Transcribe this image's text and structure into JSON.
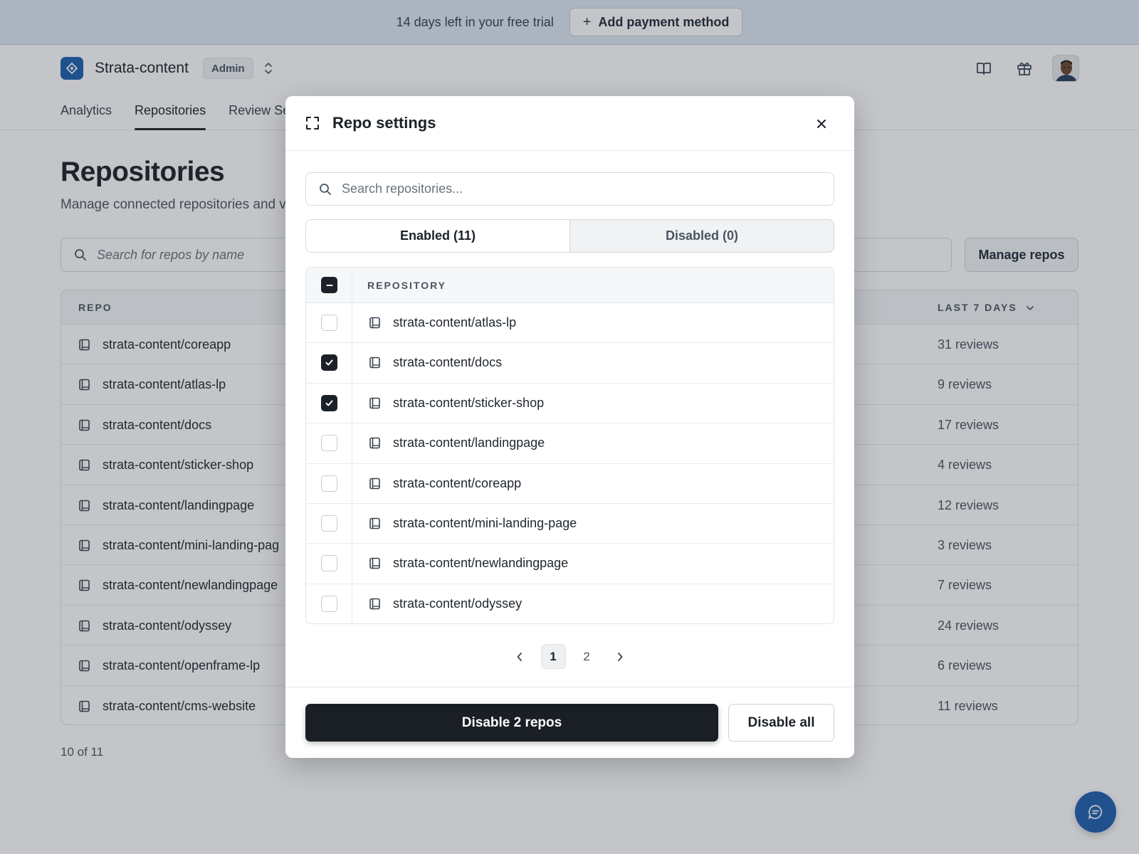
{
  "trial": {
    "text": "14 days left in your free trial",
    "button_label": "Add payment method"
  },
  "header": {
    "org_name": "Strata-content",
    "role_badge": "Admin"
  },
  "nav": {
    "tabs": [
      {
        "label": "Analytics"
      },
      {
        "label": "Repositories"
      },
      {
        "label": "Review Se"
      }
    ]
  },
  "page": {
    "title": "Repositories",
    "subtitle": "Manage connected repositories and vi",
    "search_placeholder": "Search for repos by name",
    "manage_button": "Manage repos",
    "table_headers": {
      "repo": "REPO",
      "last7": "LAST 7 DAYS"
    },
    "rows": [
      {
        "name": "strata-content/coreapp",
        "reviews": "31 reviews"
      },
      {
        "name": "strata-content/atlas-lp",
        "reviews": "9 reviews"
      },
      {
        "name": "strata-content/docs",
        "reviews": "17 reviews"
      },
      {
        "name": "strata-content/sticker-shop",
        "reviews": "4 reviews"
      },
      {
        "name": "strata-content/landingpage",
        "reviews": "12 reviews"
      },
      {
        "name": "strata-content/mini-landing-pag",
        "reviews": "3 reviews"
      },
      {
        "name": "strata-content/newlandingpage",
        "reviews": "7 reviews"
      },
      {
        "name": "strata-content/odyssey",
        "reviews": "24 reviews"
      },
      {
        "name": "strata-content/openframe-lp",
        "reviews": "6 reviews"
      },
      {
        "name": "strata-content/cms-website",
        "reviews": "11 reviews"
      }
    ],
    "count_text": "10 of 11"
  },
  "modal": {
    "title": "Repo settings",
    "search_placeholder": "Search repositories...",
    "tabs": {
      "enabled": "Enabled (11)",
      "disabled": "Disabled (0)"
    },
    "table_header": "REPOSITORY",
    "rows": [
      {
        "name": "strata-content/atlas-lp",
        "checked": false
      },
      {
        "name": "strata-content/docs",
        "checked": true
      },
      {
        "name": "strata-content/sticker-shop",
        "checked": true
      },
      {
        "name": "strata-content/landingpage",
        "checked": false
      },
      {
        "name": "strata-content/coreapp",
        "checked": false
      },
      {
        "name": "strata-content/mini-landing-page",
        "checked": false
      },
      {
        "name": "strata-content/newlandingpage",
        "checked": false
      },
      {
        "name": "strata-content/odyssey",
        "checked": false
      }
    ],
    "pagination": {
      "pages": [
        "1",
        "2"
      ],
      "current": "1"
    },
    "primary_button": "Disable 2 repos",
    "secondary_button": "Disable all"
  },
  "colors": {
    "brand": "#1f5fae",
    "dark_button": "#1a1f26",
    "trial_bar": "#dfe8f3"
  }
}
